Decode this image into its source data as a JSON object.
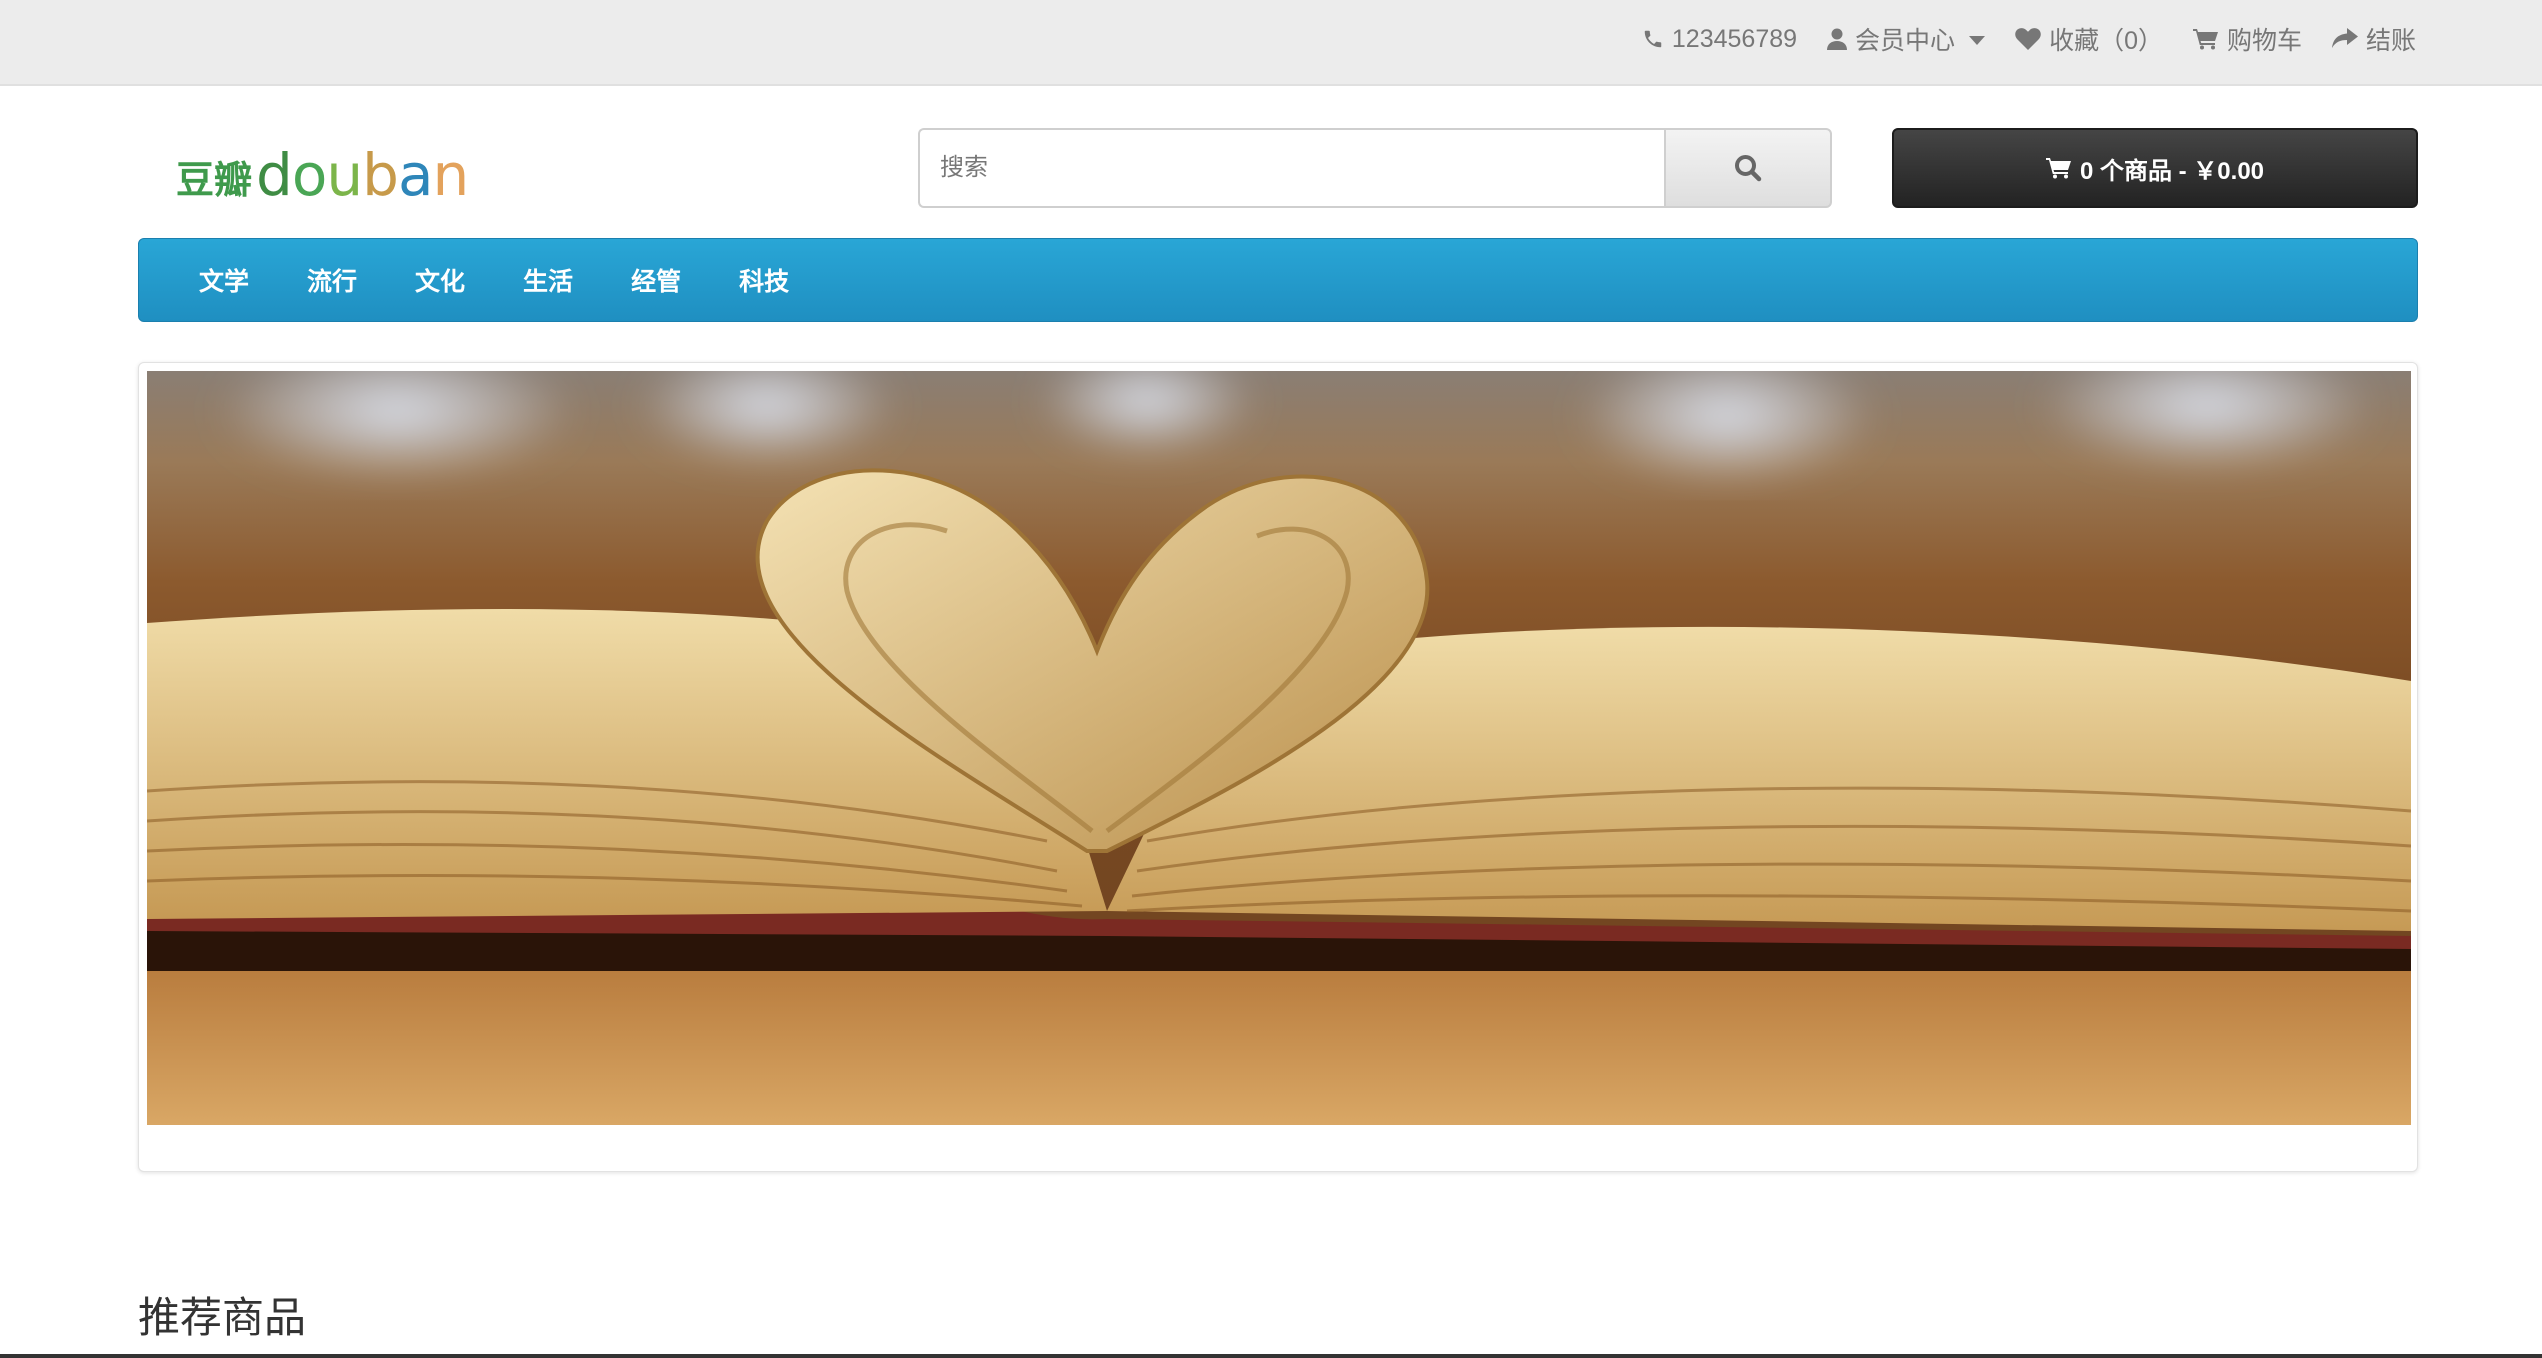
{
  "topbar": {
    "phone": "123456789",
    "member_center": "会员中心",
    "favorites": "收藏（0）",
    "cart": "购物车",
    "checkout": "结账",
    "icons": [
      "phone-icon",
      "user-icon",
      "heart-icon",
      "cart-icon",
      "share-icon"
    ]
  },
  "header": {
    "logo_cn": "豆瓣",
    "logo_en": [
      "d",
      "o",
      "u",
      "b",
      "a",
      "n"
    ],
    "search": {
      "placeholder": "搜索",
      "value": ""
    },
    "cart_button": "0 个商品 - ￥0.00"
  },
  "nav": {
    "items": [
      "文学",
      "流行",
      "文化",
      "生活",
      "经管",
      "科技"
    ]
  },
  "main": {
    "section_title": "推荐商品"
  },
  "colors": {
    "topbar_bg": "#ececec",
    "nav_bg": "#23a0d3",
    "cart_button_bg": "#2f2f2f"
  }
}
